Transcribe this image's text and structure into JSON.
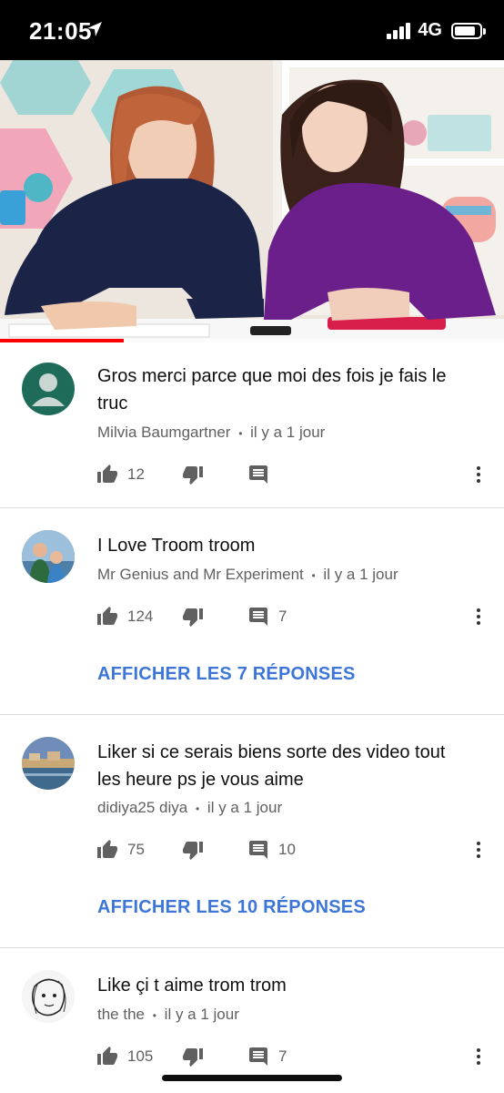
{
  "status_bar": {
    "time": "21:05",
    "network": "4G",
    "battery_level": 0.85
  },
  "video": {
    "progress": 0.245
  },
  "comments": [
    {
      "text": "Gros merci parce que moi des fois je fais le truc",
      "author": "Milvia Baumgartner",
      "time": "il y a 1 jour",
      "likes": "12",
      "reply_count": "",
      "show_replies": "",
      "avatar_icon": "default-user-avatar"
    },
    {
      "text": "I Love Troom troom",
      "author": "Mr Genius and Mr Experiment",
      "time": "il y a 1 jour",
      "likes": "124",
      "reply_count": "7",
      "show_replies": "AFFICHER LES 7 RÉPONSES",
      "avatar_icon": "photo-avatar"
    },
    {
      "text": "Liker si ce serais biens sorte des video tout les heure ps je vous aime",
      "author": "didiya25 diya",
      "time": "il y a 1 jour",
      "likes": "75",
      "reply_count": "10",
      "show_replies": "AFFICHER LES 10 RÉPONSES",
      "avatar_icon": "photo-avatar"
    },
    {
      "text": "Like çi t aime trom trom",
      "author": "the the",
      "time": "il y a 1 jour",
      "likes": "105",
      "reply_count": "7",
      "show_replies": "",
      "avatar_icon": "drawing-avatar"
    }
  ],
  "meta_separator": "•",
  "colors": {
    "link": "#3d76d8",
    "progress": "#ff0000",
    "secondary_text": "#606060",
    "status_bar": "#000000"
  }
}
